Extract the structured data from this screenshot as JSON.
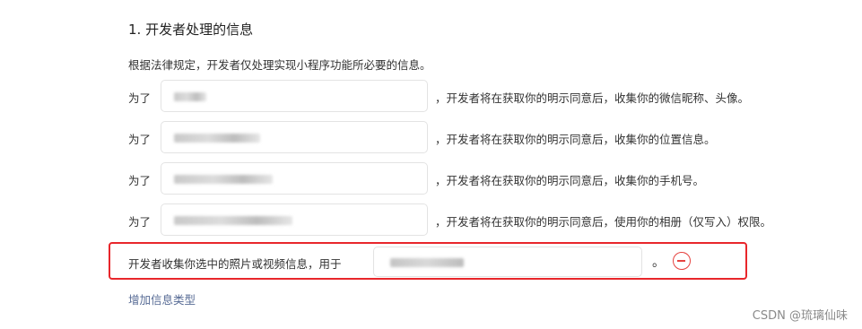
{
  "section": {
    "title": "1. 开发者处理的信息",
    "intro": "根据法律规定，开发者仅处理实现小程序功能所必要的信息。"
  },
  "rows": [
    {
      "prefix": "为了",
      "suffix": "，开发者将在获取你的明示同意后，收集你的微信昵称、头像。"
    },
    {
      "prefix": "为了",
      "suffix": "，开发者将在获取你的明示同意后，收集你的位置信息。"
    },
    {
      "prefix": "为了",
      "suffix": "，开发者将在获取你的明示同意后，收集你的手机号。"
    },
    {
      "prefix": "为了",
      "suffix": "，开发者将在获取你的明示同意后，使用你的相册（仅写入）权限。"
    }
  ],
  "media_row": {
    "label": "开发者收集你选中的照片或视频信息，用于",
    "period": "。",
    "remove_icon": "minus-circle-icon",
    "highlight_color": "#e8262b"
  },
  "add_type_link": "增加信息类型",
  "watermark": "CSDN @琉璃仙味",
  "colors": {
    "link": "#576b95",
    "danger": "#e64340"
  }
}
